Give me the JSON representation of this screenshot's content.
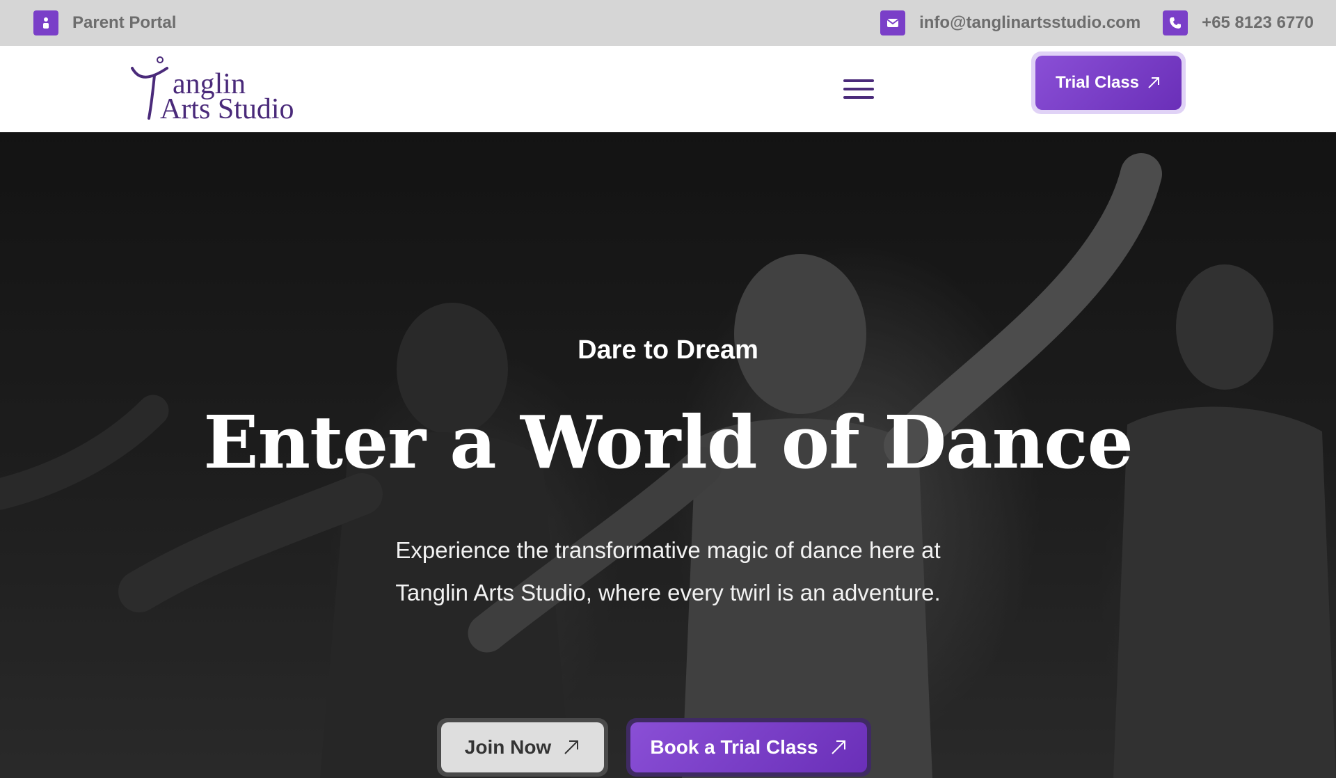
{
  "topbar": {
    "parent_portal": "Parent Portal",
    "email": "info@tanglinartsstudio.com",
    "phone": "+65 8123 6770"
  },
  "header": {
    "logo_line1": "anglin",
    "logo_line2": "Arts Studio",
    "trial_button": "Trial Class"
  },
  "hero": {
    "eyebrow": "Dare to Dream",
    "title": "Enter a World of Dance",
    "description": "Experience the transformative magic of dance here at Tanglin Arts Studio, where every twirl is an adventure.",
    "join_button": "Join Now",
    "book_button": "Book a Trial Class"
  },
  "colors": {
    "accent": "#7a3fc8",
    "brand_text": "#4a2a7a",
    "topbar_bg": "#d6d6d6"
  },
  "icons": {
    "parent_portal": "user-icon",
    "email": "mail-icon",
    "phone": "phone-icon",
    "menu": "hamburger-menu-icon",
    "cta": "arrow-up-right-icon"
  }
}
